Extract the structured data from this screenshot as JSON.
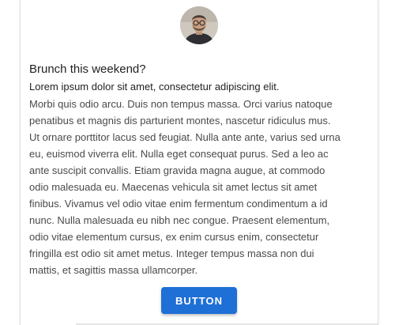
{
  "card": {
    "title": "Brunch this weekend?",
    "subtitle": "Lorem ipsum dolor sit amet, consectetur adipiscing elit.",
    "body_lines": [
      "Morbi quis odio arcu. Duis non tempus massa. Orci varius natoque",
      "penatibus et magnis dis parturient montes, nascetur ridiculus mus.",
      "Ut ornare porttitor lacus sed feugiat. Nulla ante ante, varius sed urna",
      "eu, euismod viverra elit. Nulla eget consequat purus. Sed a leo ac",
      "ante suscipit convallis. Etiam gravida magna augue, at commodo",
      "odio malesuada eu. Maecenas vehicula sit amet lectus sit amet",
      "finibus. Vivamus vel odio vitae enim fermentum condimentum a id",
      "nunc. Nulla malesuada eu nibh nec congue. Praesent elementum,",
      "odio vitae elementum cursus, ex enim cursus enim, consectetur",
      "fringilla est odio sit amet metus. Integer tempus massa non dui",
      "mattis, et sagittis massa ullamcorper."
    ],
    "button_label": "BUTTON",
    "avatar_icon": "avatar-photo",
    "accent_color": "#1e6fd6"
  }
}
